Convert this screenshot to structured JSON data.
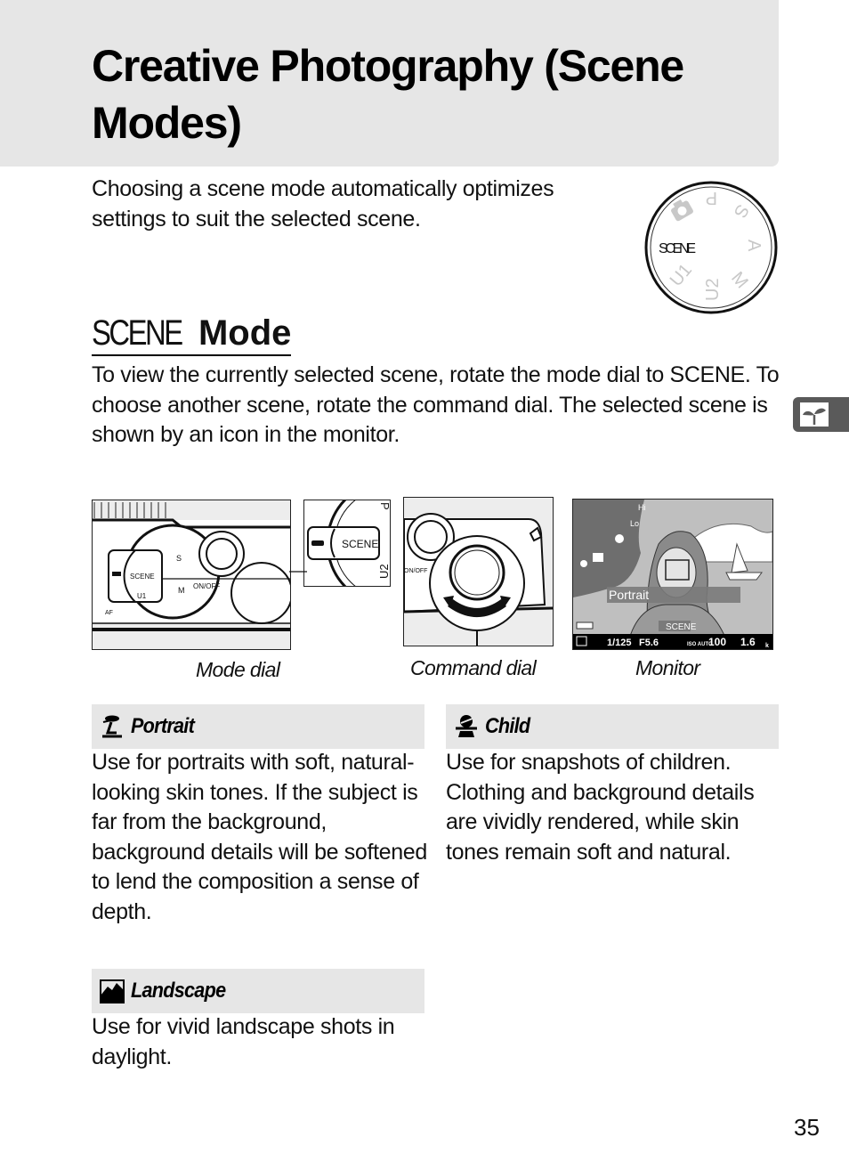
{
  "page": {
    "title": "Creative Photography (Scene Modes)",
    "intro": "Choosing a scene mode automatically optimizes settings to suit the selected scene.",
    "page_number": "35",
    "side_tab_icon": "sprout-icon"
  },
  "mode_dial": {
    "selected": "SCENE",
    "positions": [
      "P",
      "S",
      "A",
      "M",
      "U2",
      "U1",
      "camera"
    ]
  },
  "section": {
    "heading_symbol": "SCENE",
    "heading_word": "Mode",
    "body": "To view the currently selected scene, rotate the mode dial to SCENE. To choose another scene, rotate the command dial.  The selected scene is shown by an icon in the monitor."
  },
  "figures": {
    "mode_dial": {
      "caption": "Mode dial",
      "labels": [
        "SCENE",
        "ON/OFF",
        "AF",
        "U1",
        "M",
        "S"
      ],
      "inset_labels": [
        "SCENE",
        "U2",
        "P"
      ]
    },
    "command_dial": {
      "caption": "Command dial",
      "labels": [
        "ON/OFF"
      ]
    },
    "monitor": {
      "caption": "Monitor",
      "scene_label": "Portrait",
      "mode_indicator": "SCENE",
      "menu_icons": [
        "Hi",
        "Lo",
        "portrait",
        "landscape",
        "child"
      ],
      "readout": {
        "metering_icon": "matrix-metering-icon",
        "shutter": "1/125",
        "aperture": "F5.6",
        "iso_label": "ISO AUTO",
        "iso": "100",
        "remaining": "1.6",
        "remaining_unit": "k"
      }
    }
  },
  "scenes": [
    {
      "name": "Portrait",
      "icon": "portrait-icon",
      "description": "Use for portraits with soft, natural-looking skin tones. If the subject is far from the background, background details will be softened to lend the composition a sense of depth."
    },
    {
      "name": "Child",
      "icon": "child-icon",
      "description": "Use for snapshots of children. Clothing and background details are vividly rendered, while skin tones remain soft and natural."
    },
    {
      "name": "Landscape",
      "icon": "landscape-icon",
      "description": "Use for vivid landscape shots in daylight."
    }
  ],
  "colors": {
    "band": "#e6e6e6",
    "side_tab": "#5a5a5a",
    "text": "#111111"
  }
}
